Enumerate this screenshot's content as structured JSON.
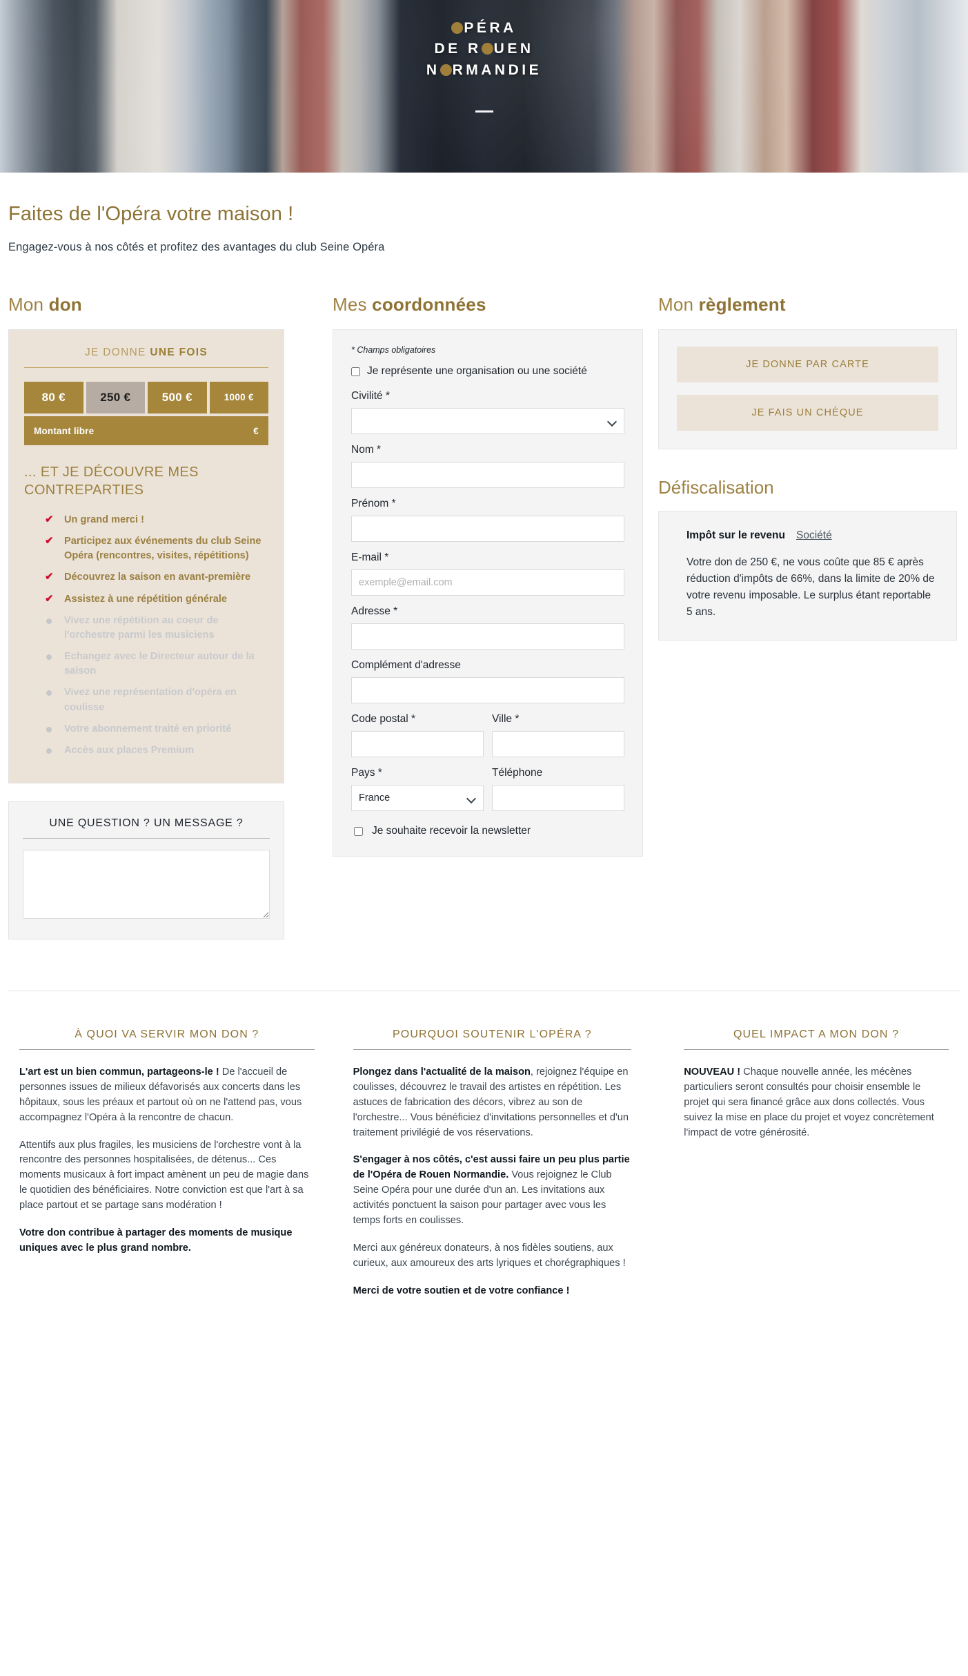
{
  "hero": {
    "logo_lines": [
      "PÉRA",
      "DE R UEN",
      "N RMANDIE"
    ],
    "logo_line1_pre": "PÉRA",
    "logo_line2_a": "DE R",
    "logo_line2_b": "UEN",
    "logo_line3_a": "N",
    "logo_line3_b": "RMANDIE",
    "gold": "#a07f3b"
  },
  "page": {
    "title": "Faites de l'Opéra votre maison !",
    "subtitle": "Engagez-vous à nos côtés et profitez des avantages du club Seine Opéra"
  },
  "don": {
    "heading_light": "Mon ",
    "heading_bold": "don",
    "tab_light": "JE DONNE ",
    "tab_bold": "UNE FOIS",
    "amounts": [
      {
        "label": "80 €",
        "selected": false
      },
      {
        "label": "250 €",
        "selected": true
      },
      {
        "label": "500 €",
        "selected": false
      },
      {
        "label": "1000 €",
        "selected": false
      }
    ],
    "free_label": "Montant libre",
    "free_currency": "€",
    "counterparts_title": "... ET JE DÉCOUVRE MES CONTREPARTIES",
    "counterparts": [
      {
        "text": "Un grand merci !",
        "active": true
      },
      {
        "text": "Participez aux événements du club Seine Opéra (rencontres, visites, répétitions)",
        "active": true
      },
      {
        "text": "Découvrez la saison en avant-première",
        "active": true
      },
      {
        "text": "Assistez à une répétition générale",
        "active": true
      },
      {
        "text": "Vivez une répétition au coeur de l'orchestre parmi les musiciens",
        "active": false
      },
      {
        "text": "Echangez avec le Directeur autour de la saison",
        "active": false
      },
      {
        "text": "Vivez une représentation d'opéra en coulisse",
        "active": false
      },
      {
        "text": "Votre abonnement traité en priorité",
        "active": false
      },
      {
        "text": "Accès aux places Premium",
        "active": false
      }
    ]
  },
  "question": {
    "title": "UNE QUESTION ? UN MESSAGE ?",
    "value": "",
    "placeholder": ""
  },
  "coordonnees": {
    "heading_light": "Mes ",
    "heading_bold": "coordonnées",
    "required_note": "* Champs obligatoires",
    "org_checkbox_label": "Je représente une organisation ou une société",
    "fields": [
      {
        "label": "Civilité *",
        "type": "select",
        "value": "",
        "placeholder": ""
      },
      {
        "label": "Nom *",
        "type": "text",
        "value": "",
        "placeholder": ""
      },
      {
        "label": "Prénom *",
        "type": "text",
        "value": "",
        "placeholder": ""
      },
      {
        "label": "E-mail *",
        "type": "email",
        "value": "",
        "placeholder": "exemple@email.com"
      },
      {
        "label": "Adresse *",
        "type": "text",
        "value": "",
        "placeholder": ""
      },
      {
        "label": "Complément d'adresse",
        "type": "text",
        "value": "",
        "placeholder": ""
      }
    ],
    "postal_label": "Code postal *",
    "city_label": "Ville *",
    "country_label": "Pays *",
    "country_value": "France",
    "phone_label": "Téléphone",
    "newsletter_label": "Je souhaite recevoir la newsletter"
  },
  "reglement": {
    "heading_light": "Mon ",
    "heading_bold": "règlement",
    "card_button": "JE DONNE PAR CARTE",
    "cheque_button": "JE FAIS UN CHÈQUE"
  },
  "defiscalisation": {
    "heading": "Défiscalisation",
    "tab_active": "Impôt sur le revenu",
    "tab_inactive": "Société",
    "text": "Votre don de 250 €, ne vous coûte que 85 € après réduction d'impôts de 66%, dans la limite de 20% de votre revenu imposable. Le surplus étant reportable 5 ans."
  },
  "bottom": {
    "col1": {
      "heading": "À QUOI VA SERVIR MON DON ?",
      "p1_bold": "L'art est un bien commun, partageons-le !",
      "p1_rest": " De l'accueil de personnes issues de milieux défavorisés aux concerts dans les hôpitaux, sous les préaux et partout où on ne l'attend pas, vous accompagnez l'Opéra à la rencontre de chacun.",
      "p2": "Attentifs aux plus fragiles, les musiciens de l'orchestre vont à la rencontre des personnes hospitalisées, de détenus... Ces moments musicaux à fort impact amènent un peu de magie dans le quotidien des bénéficiaires. Notre conviction est que l'art à sa place partout et se partage sans modération !",
      "p3_bold": "Votre don contribue à partager des moments de musique uniques avec le plus grand nombre."
    },
    "col2": {
      "heading": "POURQUOI SOUTENIR L'OPÉRA ?",
      "p1_bold": "Plongez dans l'actualité de la maison",
      "p1_rest": ", rejoignez l'équipe en coulisses, découvrez le travail des artistes en répétition. Les astuces de fabrication des décors, vibrez au son de l'orchestre... Vous bénéficiez d'invitations personnelles et d'un traitement privilégié de vos réservations.",
      "p2_bold": "S'engager à nos côtés, c'est aussi faire un peu plus partie de l'Opéra de Rouen Normandie.",
      "p2_rest": " Vous rejoignez le Club Seine Opéra pour une durée d'un an. Les invitations aux activités ponctuent la saison pour partager avec vous les temps forts en coulisses.",
      "p3": "Merci aux généreux donateurs, à nos fidèles soutiens, aux curieux, aux amoureux des arts lyriques et chorégraphiques !",
      "p4_bold": "Merci de votre soutien et de votre confiance !"
    },
    "col3": {
      "heading": "QUEL IMPACT A MON DON ?",
      "p1_bold": "NOUVEAU !",
      "p1_rest": " Chaque nouvelle année, les mécènes particuliers seront consultés pour choisir ensemble le projet qui sera financé grâce aux dons collectés. Vous suivez la mise en place du projet et voyez concrètement l'impact de votre générosité."
    }
  }
}
